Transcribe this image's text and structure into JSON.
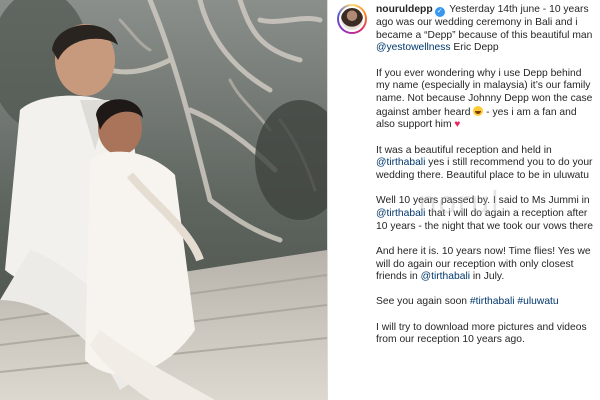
{
  "post": {
    "username": "nouruldepp",
    "caption_paragraphs": [
      {
        "segments": [
          {
            "type": "text",
            "value": " Yesterday 14th june - 10 years ago was our wedding ceremony in Bali and i became a “Depp” because of this beautiful man "
          },
          {
            "type": "mention",
            "value": "@yestowellness"
          },
          {
            "type": "text",
            "value": " Eric Depp"
          }
        ]
      },
      {
        "segments": [
          {
            "type": "text",
            "value": "If you ever wondering why i use Depp behind my name (especially in malaysia) it’s our family name. Not because Johnny Depp won the case against amber heard "
          },
          {
            "type": "emoji",
            "value": "laughing-emoji"
          },
          {
            "type": "text",
            "value": " - yes i am a fan and also support him "
          },
          {
            "type": "emoji",
            "value": "heart-emoji"
          }
        ]
      },
      {
        "segments": [
          {
            "type": "text",
            "value": "It was a beautiful reception and  held in "
          },
          {
            "type": "mention",
            "value": "@tirthabali"
          },
          {
            "type": "text",
            "value": "  yes i still recommend you to do your wedding there. Beautiful place to be in uluwatu"
          }
        ]
      },
      {
        "segments": [
          {
            "type": "text",
            "value": "Well 10 years passed by. I said to Ms Jummi in "
          },
          {
            "type": "mention",
            "value": "@tirthabali"
          },
          {
            "type": "text",
            "value": " that i will do again a reception after 10 years - the night that we took our vows there"
          }
        ]
      },
      {
        "segments": [
          {
            "type": "text",
            "value": "And here it is. 10 years now! Time flies! Yes we will do again our reception with only closest friends in "
          },
          {
            "type": "mention",
            "value": "@tirthabali"
          },
          {
            "type": "text",
            "value": " in July."
          }
        ]
      },
      {
        "segments": [
          {
            "type": "text",
            "value": "See you again soon "
          },
          {
            "type": "hashtag",
            "value": "#tirthabali"
          },
          {
            "type": "text",
            "value": " "
          },
          {
            "type": "hashtag",
            "value": "#uluwatu"
          }
        ]
      },
      {
        "segments": [
          {
            "type": "text",
            "value": "I will try to download more pictures and videos from our reception 10 years ago."
          }
        ]
      }
    ]
  },
  "watermark": "norul",
  "icons": {
    "verified": "verified-badge-icon",
    "avatar": "profile-avatar"
  },
  "colors": {
    "link": "#00376b",
    "verified": "#3897f0",
    "text": "#262626"
  }
}
